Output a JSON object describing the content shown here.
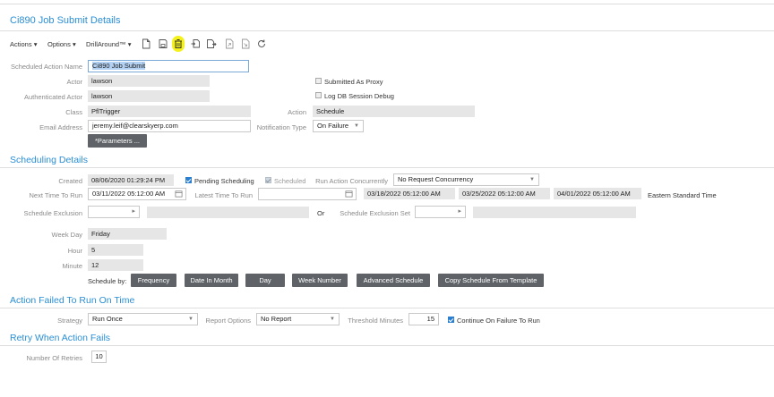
{
  "page": {
    "title": "Ci890 Job Submit Details"
  },
  "toolbar": {
    "actions_label": "Actions",
    "options_label": "Options",
    "drillaround_label": "DrillAround™",
    "icons": [
      "new-document-icon",
      "save-icon",
      "delete-icon",
      "copy-icon",
      "forward-icon",
      "open-link-icon",
      "external-link-icon",
      "refresh-icon"
    ],
    "highlight_color": "#f4f21a"
  },
  "job": {
    "scheduled_action_name_label": "Scheduled Action Name",
    "scheduled_action_name": "Ci890 Job Submit",
    "actor_label": "Actor",
    "actor": "lawson",
    "authenticated_actor_label": "Authenticated Actor",
    "authenticated_actor": "lawson",
    "class_label": "Class",
    "class": "PflTrigger",
    "email_label": "Email Address",
    "email": "jeremy.leif@clearskyerp.com",
    "parameters_button": "*Parameters ...",
    "submitted_as_proxy": "Submitted As Proxy",
    "log_db_session_debug": "Log DB Session Debug",
    "action_label": "Action",
    "action": "Schedule",
    "notification_type_label": "Notification Type",
    "notification_type": "On Failure"
  },
  "scheduling": {
    "title": "Scheduling Details",
    "created_label": "Created",
    "created": "08/06/2020 01:29:24 PM",
    "pending_scheduling": "Pending Scheduling",
    "scheduled": "Scheduled",
    "run_action_concurrently_label": "Run Action Concurrently",
    "run_action_concurrently": "No Request Concurrency",
    "next_time_label": "Next Time To Run",
    "next_time": "03/11/2022 05:12:00 AM",
    "latest_time_label": "Latest Time To Run",
    "latest_time": "",
    "next_runs": [
      "03/18/2022 05:12:00 AM",
      "03/25/2022 05:12:00 AM",
      "04/01/2022 05:12:00 AM"
    ],
    "timezone": "Eastern Standard Time",
    "schedule_exclusion_label": "Schedule Exclusion",
    "or_label": "Or",
    "schedule_exclusion_set_label": "Schedule Exclusion Set",
    "week_day_label": "Week Day",
    "week_day": "Friday",
    "hour_label": "Hour",
    "hour": "5",
    "minute_label": "Minute",
    "minute": "12",
    "schedule_by_label": "Schedule by:",
    "schedule_buttons": [
      "Frequency",
      "Date In Month",
      "Day",
      "Week Number",
      "Advanced Schedule",
      "Copy Schedule From Template"
    ]
  },
  "failed": {
    "title": "Action Failed To Run On Time",
    "strategy_label": "Strategy",
    "strategy": "Run Once",
    "report_options_label": "Report Options",
    "report_options": "No Report",
    "threshold_label": "Threshold Minutes",
    "threshold": "15",
    "continue_on_failure": "Continue On Failure To Run"
  },
  "retry": {
    "title": "Retry When Action Fails",
    "number_of_retries_label": "Number Of Retries",
    "number_of_retries": "10"
  }
}
